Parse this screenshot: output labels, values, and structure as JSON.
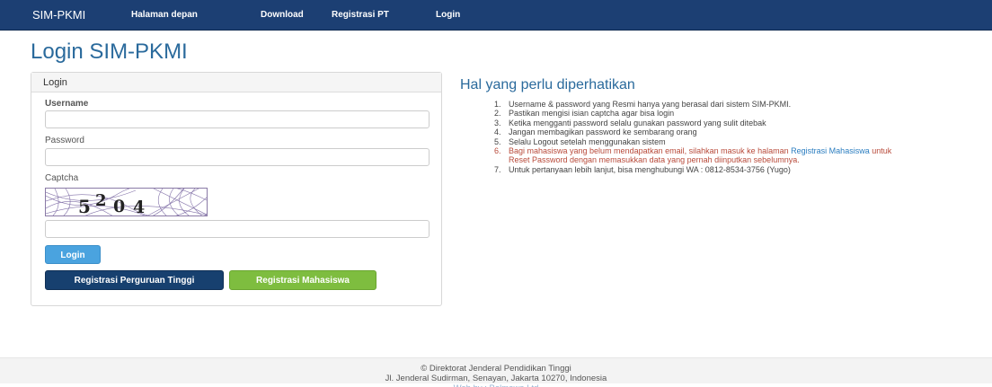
{
  "navbar": {
    "brand": "SIM-PKMI",
    "links": [
      "Halaman depan",
      "Download",
      "Registrasi PT",
      "Login"
    ]
  },
  "page_title": "Login SIM-PKMI",
  "login_panel": {
    "heading": "Login",
    "username_label": "Username",
    "username_value": "",
    "password_label": "Password",
    "password_value": "",
    "captcha_label": "Captcha",
    "captcha_text": "5204",
    "captcha_value": "",
    "login_button": "Login",
    "register_pt_button": "Registrasi Perguruan Tinggi",
    "register_mhs_button": "Registrasi Mahasiswa"
  },
  "notes": {
    "title": "Hal yang perlu diperhatikan",
    "items": [
      {
        "num": "1.",
        "text": "Username & password yang Resmi hanya yang berasal dari sistem SIM-PKMI."
      },
      {
        "num": "2.",
        "text": "Pastikan mengisi isian captcha agar bisa login"
      },
      {
        "num": "3.",
        "text": "Ketika mengganti password selalu gunakan password yang sulit ditebak"
      },
      {
        "num": "4.",
        "text": "Jangan membagikan password ke sembarang orang"
      },
      {
        "num": "5.",
        "text": "Selalu Logout setelah menggunakan sistem"
      },
      {
        "num": "6.",
        "text_before": "Bagi mahasiswa yang belum mendapatkan email, silahkan masuk ke halaman ",
        "link": "Registrasi Mahasiswa",
        "text_after": " untuk Reset Password dengan memasukkan data yang pernah diinputkan sebelumnya."
      },
      {
        "num": "7.",
        "text": "Untuk pertanyaan lebih lanjut, bisa menghubungi WA : 0812-8534-3756 (Yugo)"
      }
    ]
  },
  "footer": {
    "line1": "© Direktorat Jenderal Pendidikan Tinggi",
    "line2": "Jl. Jenderal Sudirman, Senayan, Jakarta 10270, Indonesia",
    "line3": "Web by : Belmawa Ltd"
  },
  "colors": {
    "navbar": "#1c3f73",
    "title_blue": "#2a6a9c",
    "login_btn": "#4aa3df",
    "pt_btn": "#17406f",
    "mhs_btn": "#7ebd3f",
    "warning_text": "#b84a3a"
  }
}
